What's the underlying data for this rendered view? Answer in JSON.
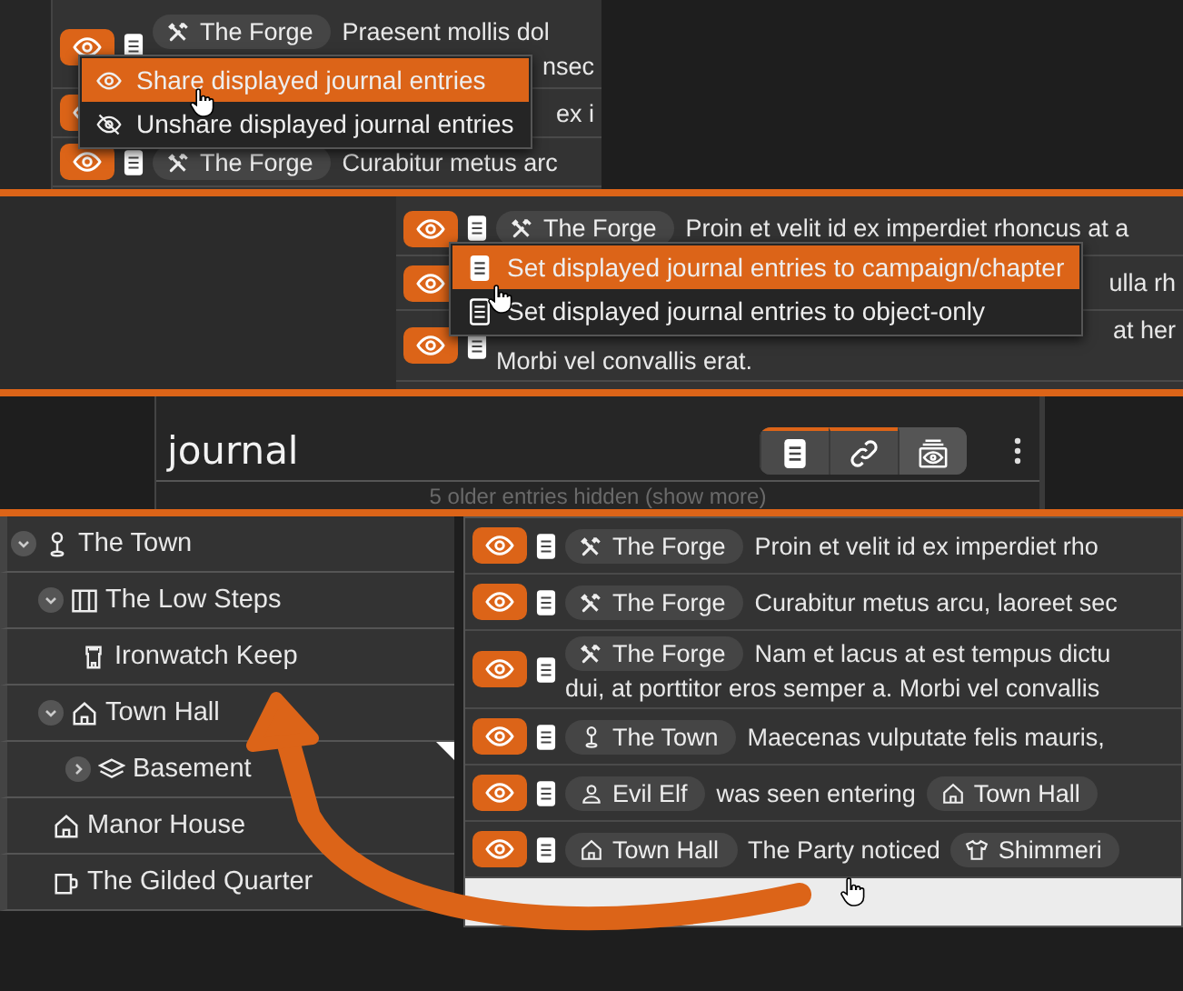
{
  "share_panel": {
    "rows": [
      {
        "shared": true,
        "obscured": false,
        "segments": [
          {
            "kind": "workshop",
            "label": "The Forge"
          },
          {
            "kind": "text",
            "text": "Praesent mollis dol"
          }
        ],
        "continuation": "nsec"
      },
      {
        "shared": true,
        "obscured": true,
        "segments": [
          {
            "kind": "text",
            "text": "ex i"
          }
        ]
      },
      {
        "shared": true,
        "obscured": false,
        "segments": [
          {
            "kind": "workshop",
            "label": "The Forge"
          },
          {
            "kind": "text",
            "text": "Curabitur metus arc"
          }
        ]
      }
    ],
    "menu": [
      {
        "label": "Share displayed journal entries",
        "selected": true
      },
      {
        "label": "Unshare displayed journal entries",
        "selected": false
      }
    ]
  },
  "scope_panel": {
    "rows": [
      {
        "shared": true,
        "obscured": false,
        "segments": [
          {
            "kind": "workshop",
            "label": "The Forge"
          },
          {
            "kind": "text",
            "text": "Proin et velit id ex imperdiet rhoncus at a"
          }
        ]
      },
      {
        "shared": true,
        "obscured": true,
        "segments": [
          {
            "kind": "text",
            "text": "ulla rh"
          }
        ]
      },
      {
        "shared": true,
        "obscured": true,
        "segments": [
          {
            "kind": "text",
            "text": "at her"
          }
        ],
        "continuation": "Morbi vel convallis erat."
      }
    ],
    "menu": [
      {
        "label": "Set displayed journal entries to campaign/chapter",
        "selected": true
      },
      {
        "label": "Set displayed journal entries to object-only",
        "selected": false
      }
    ]
  },
  "journal_header": {
    "title": "journal",
    "toolbar": [
      {
        "selected": true
      },
      {
        "selected": true
      },
      {
        "selected": false
      }
    ],
    "hidden_notice": "5 older entries hidden (show more)"
  },
  "journal_panel": {
    "tree": [
      {
        "label": "The Town",
        "kind": "landmark",
        "expanded": true,
        "children": [
          {
            "label": "The Low Steps",
            "kind": "district",
            "expanded": true,
            "children": [
              {
                "label": "Ironwatch Keep",
                "kind": "tower"
              }
            ]
          },
          {
            "label": "Town Hall",
            "kind": "building",
            "expanded": true,
            "children": [
              {
                "label": "Basement",
                "kind": "level",
                "expanded": false,
                "flagged": true
              }
            ]
          },
          {
            "label": "Manor House",
            "kind": "building"
          },
          {
            "label": "The Gilded Quarter",
            "kind": "tavern"
          }
        ]
      }
    ],
    "rows": [
      {
        "shared": true,
        "obscured": false,
        "segments": [
          {
            "kind": "workshop",
            "label": "The Forge"
          },
          {
            "kind": "text",
            "text": "Proin et velit id ex imperdiet rho"
          }
        ]
      },
      {
        "shared": true,
        "obscured": false,
        "segments": [
          {
            "kind": "workshop",
            "label": "The Forge"
          },
          {
            "kind": "text",
            "text": "Curabitur metus arcu, laoreet sec"
          }
        ]
      },
      {
        "shared": true,
        "obscured": false,
        "segments": [
          {
            "kind": "workshop",
            "label": "The Forge"
          },
          {
            "kind": "text",
            "text": "Nam et lacus at est tempus dictu"
          }
        ],
        "continuation": "dui, at porttitor eros semper a. Morbi vel convallis"
      },
      {
        "shared": true,
        "obscured": false,
        "segments": [
          {
            "kind": "landmark",
            "label": "The Town"
          },
          {
            "kind": "text",
            "text": "Maecenas vulputate felis mauris,"
          }
        ]
      },
      {
        "shared": true,
        "obscured": false,
        "segments": [
          {
            "kind": "character",
            "label": "Evil Elf"
          },
          {
            "kind": "text",
            "text": "was seen entering"
          },
          {
            "kind": "building",
            "label": "Town Hall"
          }
        ]
      },
      {
        "shared": true,
        "obscured": false,
        "segments": [
          {
            "kind": "building",
            "label": "Town Hall"
          },
          {
            "kind": "text",
            "text": "The Party noticed"
          },
          {
            "kind": "clothing",
            "label": "Shimmeri"
          }
        ]
      }
    ]
  }
}
